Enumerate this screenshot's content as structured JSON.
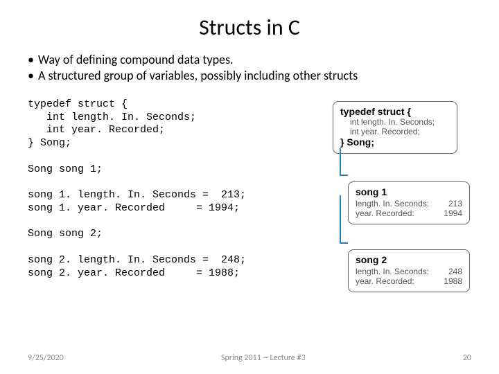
{
  "title": "Structs in C",
  "bullets": [
    "Way of defining compound data types.",
    "A structured group of variables, possibly including other structs"
  ],
  "code": "typedef struct {\n   int length. In. Seconds;\n   int year. Recorded;\n} Song;\n\nSong song 1;\n\nsong 1. length. In. Seconds =  213;\nsong 1. year. Recorded     = 1994;\n\nSong song 2;\n\nsong 2. length. In. Seconds =  248;\nsong 2. year. Recorded     = 1988;",
  "diagram": {
    "struct": {
      "header": "typedef struct {",
      "line1": "int length. In. Seconds;",
      "line2": "int year. Recorded;",
      "footer": "} Song;"
    },
    "song1": {
      "name": "song 1",
      "k1": "length. In. Seconds:",
      "v1": "213",
      "k2": "year. Recorded:",
      "v2": "1994"
    },
    "song2": {
      "name": "song 2",
      "k1": "length. In. Seconds:",
      "v1": "248",
      "k2": "year. Recorded:",
      "v2": "1988"
    }
  },
  "footer": {
    "left": "9/25/2020",
    "center": "Spring 2011 -- Lecture #3",
    "right": "20"
  }
}
